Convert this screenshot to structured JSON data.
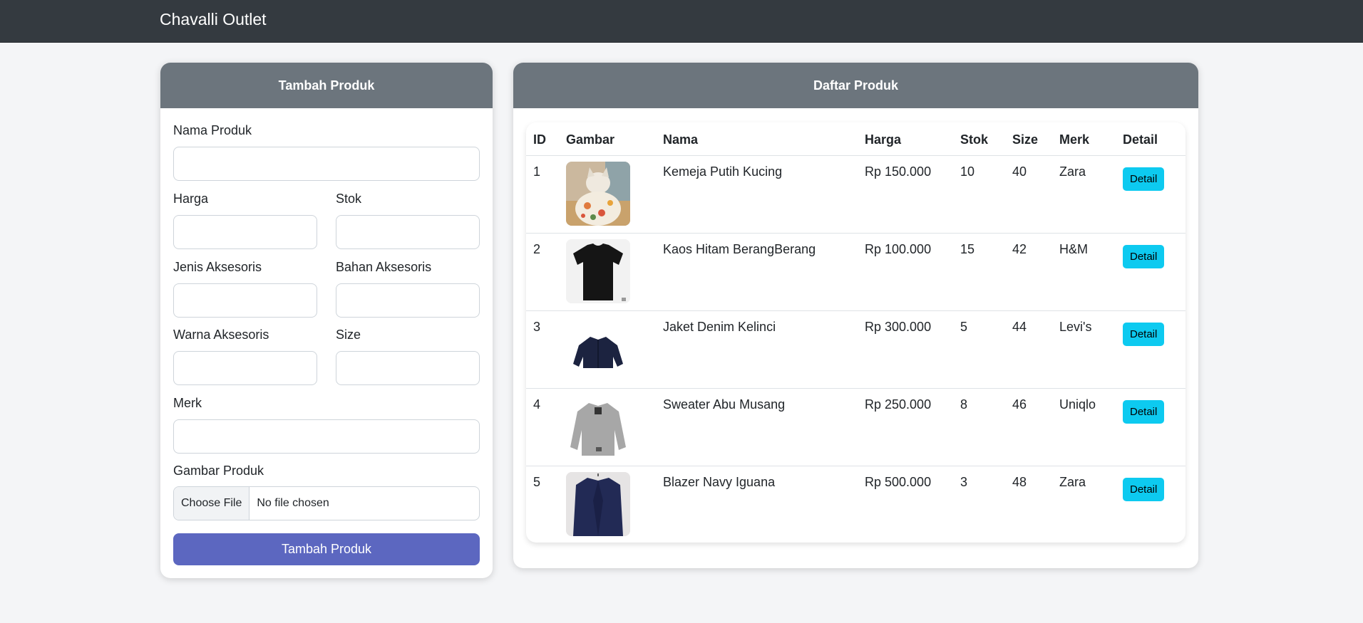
{
  "navbar": {
    "brand": "Chavalli Outlet"
  },
  "form": {
    "title": "Tambah Produk",
    "fields": {
      "nama": {
        "label": "Nama Produk",
        "value": ""
      },
      "harga": {
        "label": "Harga",
        "value": ""
      },
      "stok": {
        "label": "Stok",
        "value": ""
      },
      "jenis": {
        "label": "Jenis Aksesoris",
        "value": ""
      },
      "bahan": {
        "label": "Bahan Aksesoris",
        "value": ""
      },
      "warna": {
        "label": "Warna Aksesoris",
        "value": ""
      },
      "size": {
        "label": "Size",
        "value": ""
      },
      "merk": {
        "label": "Merk",
        "value": ""
      },
      "gambar": {
        "label": "Gambar Produk",
        "button": "Choose File",
        "status": "No file chosen"
      }
    },
    "submit_label": "Tambah Produk"
  },
  "list": {
    "title": "Daftar Produk",
    "columns": [
      "ID",
      "Gambar",
      "Nama",
      "Harga",
      "Stok",
      "Size",
      "Merk",
      "Detail"
    ],
    "rows": [
      {
        "id": "1",
        "image": "cat-in-floral-shirt",
        "nama": "Kemeja Putih Kucing",
        "harga": "Rp 150.000",
        "stok": "10",
        "size": "40",
        "merk": "Zara",
        "detail": "Detail"
      },
      {
        "id": "2",
        "image": "black-tshirt",
        "nama": "Kaos Hitam BerangBerang",
        "harga": "Rp 100.000",
        "stok": "15",
        "size": "42",
        "merk": "H&M",
        "detail": "Detail"
      },
      {
        "id": "3",
        "image": "denim-jacket",
        "nama": "Jaket Denim Kelinci",
        "harga": "Rp 300.000",
        "stok": "5",
        "size": "44",
        "merk": "Levi's",
        "detail": "Detail"
      },
      {
        "id": "4",
        "image": "grey-sweater",
        "nama": "Sweater Abu Musang",
        "harga": "Rp 250.000",
        "stok": "8",
        "size": "46",
        "merk": "Uniqlo",
        "detail": "Detail"
      },
      {
        "id": "5",
        "image": "navy-blazer",
        "nama": "Blazer Navy Iguana",
        "harga": "Rp 500.000",
        "stok": "3",
        "size": "48",
        "merk": "Zara",
        "detail": "Detail"
      }
    ]
  },
  "colors": {
    "navbar": "#343a40",
    "card_header": "#6c757d",
    "submit": "#5c67c0",
    "detail": "#0dcaf0"
  }
}
